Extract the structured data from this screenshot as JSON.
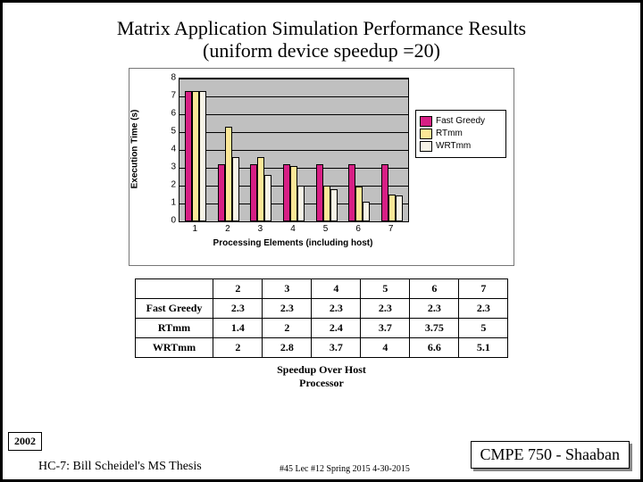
{
  "title_line1": "Matrix Application Simulation Performance Results",
  "title_line2": "(uniform device speedup =20)",
  "chart_data": {
    "type": "bar",
    "ylabel": "Execution Time (s)",
    "xlabel": "Processing Elements (including host)",
    "ylim": [
      0,
      8
    ],
    "yticks": [
      0,
      1,
      2,
      3,
      4,
      5,
      6,
      7,
      8
    ],
    "categories": [
      "1",
      "2",
      "3",
      "4",
      "5",
      "6",
      "7"
    ],
    "series": [
      {
        "name": "Fast Greedy",
        "color": "#d71f85",
        "values": [
          7.3,
          3.2,
          3.2,
          3.2,
          3.2,
          3.2,
          3.2
        ]
      },
      {
        "name": "RTmm",
        "color": "#fbe797",
        "values": [
          7.3,
          5.3,
          3.6,
          3.1,
          2.0,
          1.95,
          1.5
        ]
      },
      {
        "name": "WRTmm",
        "color": "#f6f3e6",
        "values": [
          7.3,
          3.6,
          2.6,
          2.0,
          1.8,
          1.1,
          1.45
        ]
      }
    ]
  },
  "table": {
    "headers": [
      "2",
      "3",
      "4",
      "5",
      "6",
      "7"
    ],
    "rows": [
      {
        "label": "Fast Greedy",
        "cells": [
          "2.3",
          "2.3",
          "2.3",
          "2.3",
          "2.3",
          "2.3"
        ]
      },
      {
        "label": "RTmm",
        "cells": [
          "1.4",
          "2",
          "2.4",
          "3.7",
          "3.75",
          "5"
        ]
      },
      {
        "label": "WRTmm",
        "cells": [
          "2",
          "2.8",
          "3.7",
          "4",
          "6.6",
          "5.1"
        ]
      }
    ],
    "caption_line1": "Speedup Over Host",
    "caption_line2": "Processor"
  },
  "footer": {
    "year": "2002",
    "thesis": "HC-7: Bill Scheidel's MS Thesis",
    "lec": "#45  Lec #12  Spring 2015  4-30-2015",
    "course": "CMPE 750 - Shaaban"
  }
}
